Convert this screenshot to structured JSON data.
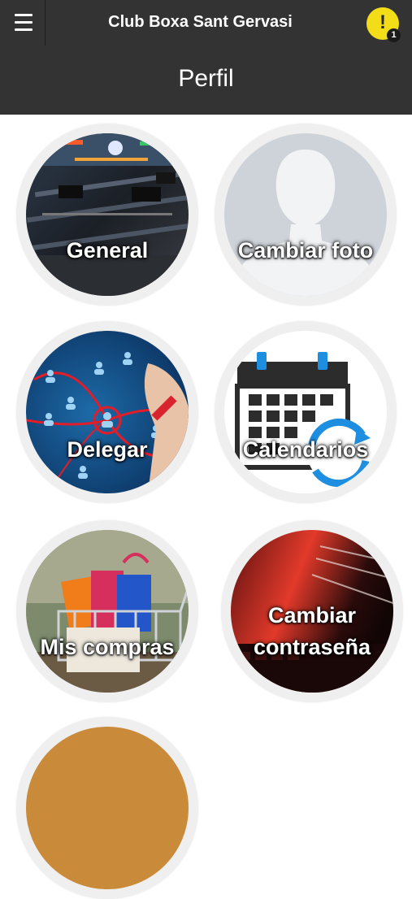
{
  "header": {
    "app_title": "Club Boxa Sant Gervasi",
    "page_title": "Perfil",
    "notifications": {
      "icon": "exclamation-icon",
      "count": "1",
      "color": "#f3dd19"
    },
    "menu_icon": "hamburger-menu-icon",
    "bar_color": "#333333"
  },
  "menu": {
    "general": "General",
    "cambiar_foto": "Cambiar foto",
    "delegar": "Delegar",
    "calendarios": "Calendarios",
    "mis_compras": "Mis compras",
    "cambiar_contrasena_line1": "Cambiar",
    "cambiar_contrasena_line2": "contraseña"
  }
}
